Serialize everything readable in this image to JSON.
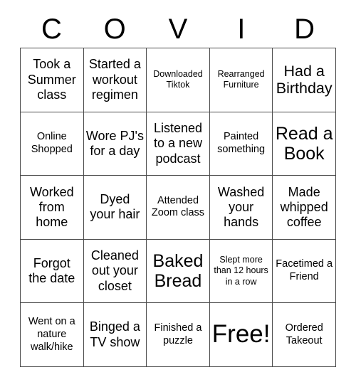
{
  "card": {
    "title_letters": [
      "C",
      "O",
      "V",
      "I",
      "D"
    ],
    "border_color": "#4a4a4a",
    "text_color": "#000000",
    "background_color": "#ffffff",
    "rows": 5,
    "columns": 5,
    "cells": [
      {
        "text": "Took a Summer class",
        "size": "m"
      },
      {
        "text": "Started a workout regimen",
        "size": "m"
      },
      {
        "text": "Downloaded Tiktok",
        "size": "xs"
      },
      {
        "text": "Rearranged Furniture",
        "size": "xs"
      },
      {
        "text": "Had a Birthday",
        "size": "l"
      },
      {
        "text": "Online Shopped",
        "size": "s"
      },
      {
        "text": "Wore PJ's for a day",
        "size": "m"
      },
      {
        "text": "Listened to a new podcast",
        "size": "m"
      },
      {
        "text": "Painted something",
        "size": "s"
      },
      {
        "text": "Read a Book",
        "size": "xl"
      },
      {
        "text": "Worked from home",
        "size": "m"
      },
      {
        "text": "Dyed your hair",
        "size": "m"
      },
      {
        "text": "Attended Zoom class",
        "size": "s"
      },
      {
        "text": "Washed your hands",
        "size": "m"
      },
      {
        "text": "Made whipped coffee",
        "size": "m"
      },
      {
        "text": "Forgot the date",
        "size": "m"
      },
      {
        "text": "Cleaned out your closet",
        "size": "m"
      },
      {
        "text": "Baked Bread",
        "size": "xl"
      },
      {
        "text": "Slept more than 12 hours in a row",
        "size": "xs"
      },
      {
        "text": "Facetimed a Friend",
        "size": "s"
      },
      {
        "text": "Went on a nature walk/hike",
        "size": "s"
      },
      {
        "text": "Binged a TV show",
        "size": "m"
      },
      {
        "text": "Finished a puzzle",
        "size": "s"
      },
      {
        "text": "Free!",
        "size": "xxl"
      },
      {
        "text": "Ordered Takeout",
        "size": "s"
      }
    ]
  }
}
